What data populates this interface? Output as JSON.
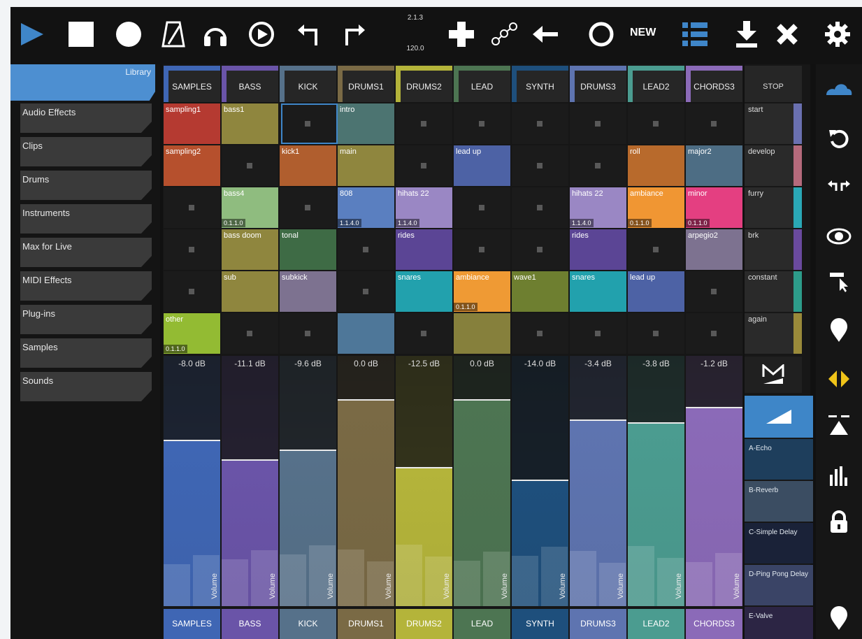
{
  "transport": {
    "time_signature": "2.1.3",
    "tempo": "120.0",
    "new_label": "NEW"
  },
  "library": {
    "title": "Library",
    "items": [
      "Audio Effects",
      "Clips",
      "Drums",
      "Instruments",
      "Max for Live",
      "MIDI Effects",
      "Plug-ins",
      "Samples",
      "Sounds"
    ]
  },
  "tracks": [
    {
      "name": "SAMPLES",
      "color": "#3f66b4",
      "db": "-8.0 dB",
      "volume_label": "Volume",
      "level": 0.66
    },
    {
      "name": "BASS",
      "color": "#6a54a8",
      "db": "-11.1 dB",
      "volume_label": "Volume",
      "level": 0.58
    },
    {
      "name": "KICK",
      "color": "#56718a",
      "db": "-9.6 dB",
      "volume_label": "Volume",
      "level": 0.62
    },
    {
      "name": "DRUMS1",
      "color": "#7a6a45",
      "db": "0.0 dB",
      "volume_label": "Volume",
      "level": 0.82
    },
    {
      "name": "DRUMS2",
      "color": "#b4b43a",
      "db": "-12.5 dB",
      "volume_label": "Volume",
      "level": 0.55
    },
    {
      "name": "LEAD",
      "color": "#4d7552",
      "db": "0.0 dB",
      "volume_label": "Volume",
      "level": 0.82
    },
    {
      "name": "SYNTH",
      "color": "#1e4f7c",
      "db": "-14.0 dB",
      "volume_label": "Volume",
      "level": 0.5
    },
    {
      "name": "DRUMS3",
      "color": "#5e74b0",
      "db": "-3.4 dB",
      "volume_label": "Volume",
      "level": 0.74
    },
    {
      "name": "LEAD2",
      "color": "#4b9c90",
      "db": "-3.8 dB",
      "volume_label": "Volume",
      "level": 0.73
    },
    {
      "name": "CHORDS3",
      "color": "#8b6ab8",
      "db": "-1.2 dB",
      "volume_label": "Volume",
      "level": 0.79
    }
  ],
  "clips": [
    [
      {
        "name": "sampling1",
        "color": "#b53a31"
      },
      {
        "name": "sampling2",
        "color": "#b6502d"
      },
      null,
      null,
      null,
      {
        "name": "other",
        "color": "#93bb33",
        "position": "0.1.1.0"
      }
    ],
    [
      {
        "name": "bass1",
        "color": "#8f863e"
      },
      null,
      {
        "name": "bass4",
        "color": "#8fbc7f",
        "position": "0.1.1.0"
      },
      {
        "name": "bass doom",
        "color": "#8f863e"
      },
      {
        "name": "sub",
        "color": "#8f863e"
      },
      null
    ],
    [
      null,
      {
        "name": "kick1",
        "color": "#b05e2e"
      },
      null,
      {
        "name": "tonal",
        "color": "#3e6b45"
      },
      {
        "name": "subkick",
        "color": "#7d7290"
      },
      null
    ],
    [
      {
        "name": "intro",
        "color": "#4c7471"
      },
      {
        "name": "main",
        "color": "#8f863e"
      },
      {
        "name": "808",
        "color": "#5a7fc0",
        "position": "1.1.4.0"
      },
      null,
      null,
      {
        "name": "",
        "color": "#4e7799"
      }
    ],
    [
      null,
      null,
      {
        "name": "hihats 22",
        "color": "#9a87c4",
        "position": "1.1.4.0"
      },
      {
        "name": "rides",
        "color": "#5b4595"
      },
      {
        "name": "snares",
        "color": "#22a1ad"
      },
      null
    ],
    [
      null,
      {
        "name": "lead up",
        "color": "#4d62a5"
      },
      null,
      null,
      {
        "name": "ambiance",
        "color": "#ef9a34",
        "position": "0.1.1.0"
      },
      {
        "name": "",
        "color": "#86803c"
      }
    ],
    [
      null,
      null,
      null,
      null,
      {
        "name": "wave1",
        "color": "#6e7f30"
      },
      null
    ],
    [
      null,
      null,
      {
        "name": "hihats 22",
        "color": "#9a87c4",
        "position": "1.1.4.0"
      },
      {
        "name": "rides",
        "color": "#5b4595"
      },
      {
        "name": "snares",
        "color": "#22a1ad"
      },
      null
    ],
    [
      null,
      {
        "name": "roll",
        "color": "#b86a2c"
      },
      {
        "name": "ambiance",
        "color": "#f09633",
        "position": "0.1.1.0"
      },
      null,
      {
        "name": "lead up",
        "color": "#4d62a5"
      },
      null
    ],
    [
      null,
      {
        "name": "major2",
        "color": "#4d6d84"
      },
      {
        "name": "minor",
        "color": "#e43f81",
        "position": "0.1.1.0"
      },
      {
        "name": "arpegio2",
        "color": "#7d7290"
      },
      null,
      null
    ]
  ],
  "scenes": {
    "stop_label": "STOP",
    "items": [
      {
        "name": "start",
        "color": "#6a70b0"
      },
      {
        "name": "develop",
        "color": "#b56a7c"
      },
      {
        "name": "furry",
        "color": "#2aa8b6"
      },
      {
        "name": "brk",
        "color": "#6a4a9e"
      },
      {
        "name": "constant",
        "color": "#2d9c8a"
      },
      {
        "name": "again",
        "color": "#9a8a3a"
      }
    ]
  },
  "sends": [
    {
      "name": "A-Echo",
      "color": "#1e3e5c"
    },
    {
      "name": "B-Reverb",
      "color": "#3b4d62"
    },
    {
      "name": "C-Simple Delay",
      "color": "#1a2238"
    },
    {
      "name": "D-Ping Pong Delay",
      "color": "#3a4466"
    },
    {
      "name": "E-Valve",
      "color": "#2c2544"
    }
  ],
  "colors": {
    "accent": "#3f86c9",
    "yellow": "#f0c419"
  }
}
